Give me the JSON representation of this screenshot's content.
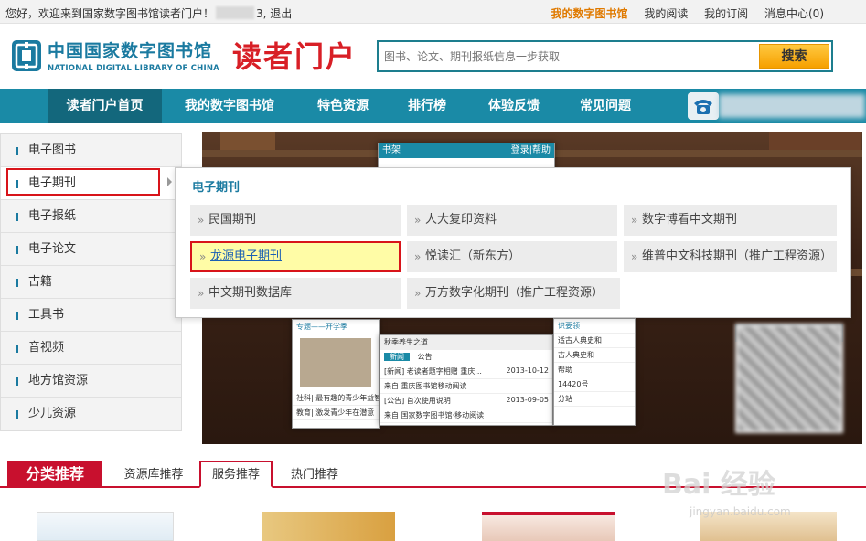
{
  "topbar": {
    "greeting_prefix": "您好，欢迎来到国家数字图书馆读者门户！",
    "greeting_suffix": "3, 退出",
    "links": [
      {
        "label": "我的数字图书馆",
        "active": true
      },
      {
        "label": "我的阅读",
        "active": false
      },
      {
        "label": "我的订阅",
        "active": false
      },
      {
        "label": "消息中心(0)",
        "active": false
      }
    ]
  },
  "header": {
    "logo_cn": "中国国家数字图书馆",
    "logo_en": "NATIONAL DIGITAL LIBRARY OF CHINA",
    "portal_title": "读者门户",
    "search_placeholder": "图书、论文、期刊报纸信息一步获取",
    "search_button": "搜索"
  },
  "nav": {
    "items": [
      {
        "label": "读者门户首页",
        "active": true
      },
      {
        "label": "我的数字图书馆",
        "active": false
      },
      {
        "label": "特色资源",
        "active": false
      },
      {
        "label": "排行榜",
        "active": false
      },
      {
        "label": "体验反馈",
        "active": false
      },
      {
        "label": "常见问题",
        "active": false
      }
    ]
  },
  "sidebar": {
    "items": [
      {
        "label": "电子图书"
      },
      {
        "label": "电子期刊",
        "selected": true
      },
      {
        "label": "电子报纸"
      },
      {
        "label": "电子论文"
      },
      {
        "label": "古籍"
      },
      {
        "label": "工具书"
      },
      {
        "label": "音视频"
      },
      {
        "label": "地方馆资源"
      },
      {
        "label": "少儿资源"
      }
    ]
  },
  "dropdown": {
    "title": "电子期刊",
    "items": [
      {
        "label": "民国期刊"
      },
      {
        "label": "人大复印资料"
      },
      {
        "label": "数字博看中文期刊"
      },
      {
        "label": "龙源电子期刊",
        "highlighted": true
      },
      {
        "label": "悦读汇（新东方）"
      },
      {
        "label": "维普中文科技期刊（推广工程资源）"
      },
      {
        "label": "中文期刊数据库"
      },
      {
        "label": "万方数字化期刊（推广工程资源）"
      }
    ]
  },
  "banner": {
    "screen1_head": "书架",
    "screen1_head_right": "登录|帮助",
    "screen2_head": "专题——开学季",
    "screen3_head": "秋季养生之道",
    "screen3_tabs": [
      "新闻",
      "公告"
    ],
    "news": [
      {
        "text": "[新闻] 老读者题字相赠 重庆...",
        "date": "2013-10-12"
      },
      {
        "text": "来自 重庆图书馆移动阅读",
        "date": ""
      },
      {
        "text": "[公告] 首次使用说明",
        "date": "2013-09-05"
      },
      {
        "text": "来自 国家数字图书馆·移动阅读",
        "date": ""
      }
    ],
    "screen2_rows": [
      "社科| 最有趣的青少年益智",
      "教育| 激发青少年在潜意"
    ],
    "screen4_rows": [
      "识要领",
      "适古人典史和",
      "古人典史和",
      "帮助",
      "14420号",
      "分站"
    ]
  },
  "bottom": {
    "category": "分类推荐",
    "tabs": [
      {
        "label": "资源库推荐",
        "active": false
      },
      {
        "label": "服务推荐",
        "active": true
      },
      {
        "label": "热门推荐",
        "active": false
      }
    ]
  },
  "watermark": {
    "brand": "Bai 经验",
    "url": "jingyan.baidu.com"
  },
  "colors": {
    "brand_teal": "#1a8aa6",
    "red": "#d8141a",
    "orange": "#e07a00",
    "highlight": "#fffca6"
  }
}
